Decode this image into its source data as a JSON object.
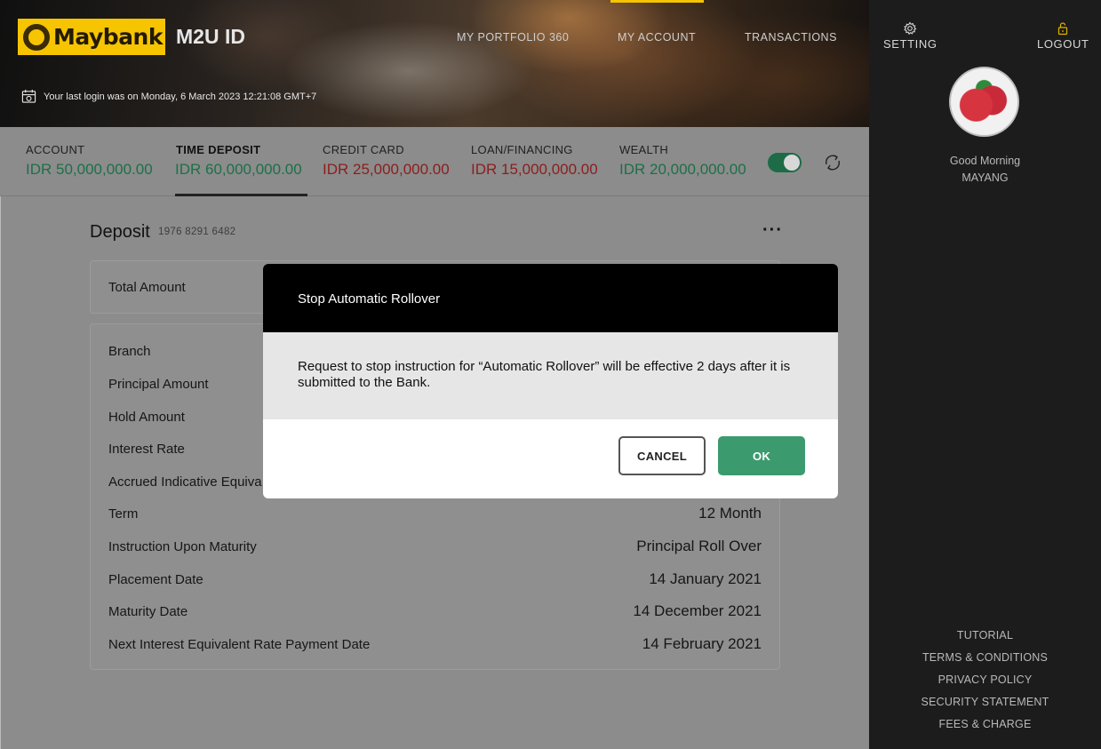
{
  "brand": {
    "logo_text": "Maybank",
    "product": "M2U ID"
  },
  "nav": {
    "items": [
      "MY PORTFOLIO 360",
      "MY ACCOUNT",
      "TRANSACTIONS"
    ]
  },
  "last_login": "Your last login was on Monday, 6 March 2023 12:21:08 GMT+7",
  "accounts": [
    {
      "label": "ACCOUNT",
      "value": "IDR 50,000,000.00"
    },
    {
      "label": "TIME DEPOSIT",
      "value": "IDR 60,000,000.00"
    },
    {
      "label": "CREDIT CARD",
      "value": "IDR 25,000,000.00"
    },
    {
      "label": "LOAN/FINANCING",
      "value": "IDR 15,000,000.00"
    },
    {
      "label": "WEALTH",
      "value": "IDR 20,000,000.00"
    }
  ],
  "deposit": {
    "title": "Deposit",
    "account_number": "1976 8291 6482",
    "more": "···",
    "total_label": "Total Amount",
    "details": [
      {
        "label": "Branch",
        "value": ""
      },
      {
        "label": "Principal Amount",
        "value": ""
      },
      {
        "label": "Hold Amount",
        "value": ""
      },
      {
        "label": "Interest Rate",
        "value": ""
      },
      {
        "label": "Accrued Indicative Equiva",
        "value": ""
      },
      {
        "label": "Term",
        "value": "12 Month"
      },
      {
        "label": "Instruction Upon Maturity",
        "value": "Principal Roll Over"
      },
      {
        "label": "Placement Date",
        "value": "14 January 2021"
      },
      {
        "label": "Maturity Date",
        "value": "14 December 2021"
      },
      {
        "label": "Next Interest Equivalent Rate Payment Date",
        "value": "14 February 2021"
      }
    ]
  },
  "dialog": {
    "title": "Stop Automatic Rollover",
    "message": "Request to stop instruction for “Automatic Rollover” will be effective 2 days after it is submitted to the Bank.",
    "cancel_label": "CANCEL",
    "ok_label": "OK"
  },
  "sidebar": {
    "setting_label": "SETTING",
    "logout_label": "LOGOUT",
    "greeting": "Good Morning",
    "user_name": "MAYANG",
    "links": [
      "TUTORIAL",
      "TERMS & CONDITIONS",
      "PRIVACY POLICY",
      "SECURITY STATEMENT",
      "FEES & CHARGE"
    ]
  },
  "colors": {
    "brand_yellow": "#f6c400",
    "ok_green": "#3c9a6f",
    "positive": "#1d6f49",
    "negative": "#8c1d1d"
  }
}
